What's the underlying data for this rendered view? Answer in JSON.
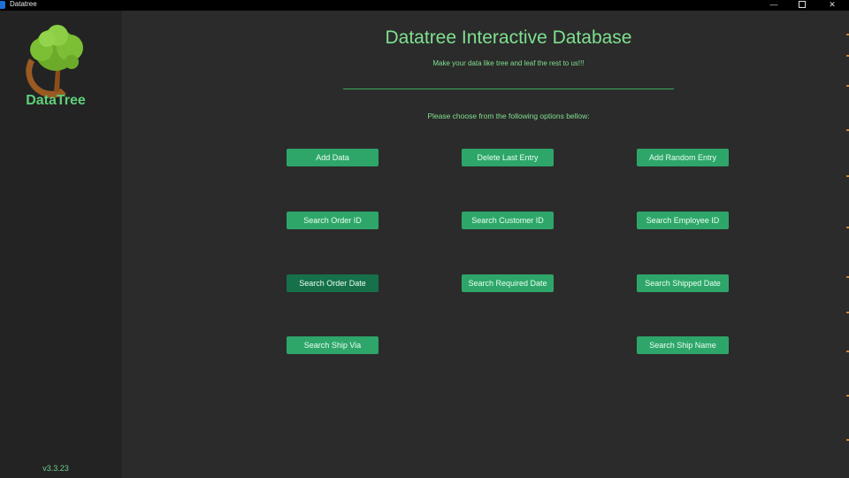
{
  "window": {
    "title": "Datatree",
    "minimize_glyph": "—",
    "close_glyph": "✕"
  },
  "sidebar": {
    "brand": "DataTree",
    "version": "v3.3.23",
    "logo_icon": "tree-logo-icon"
  },
  "main": {
    "title": "Datatree Interactive Database",
    "subtitle": "Make your data like tree and leaf the rest to us!!!",
    "instruction": "Please choose from the following options bellow:"
  },
  "buttons": {
    "add_data": "Add Data",
    "delete_last_entry": "Delete Last Entry",
    "add_random_entry": "Add Random Entry",
    "search_order_id": "Search Order ID",
    "search_customer_id": "Search Customer ID",
    "search_employee_id": "Search Employee ID",
    "search_order_date": "Search Order Date",
    "search_required_date": "Search Required Date",
    "search_shipped_date": "Search Shipped Date",
    "search_ship_via": "Search Ship Via",
    "search_ship_name": "Search Ship Name"
  },
  "colors": {
    "accent": "#2ea66a",
    "accent_pressed": "#16704a",
    "text_green": "#7fe08f",
    "background": "#2b2b2b",
    "sidebar": "#232323"
  }
}
